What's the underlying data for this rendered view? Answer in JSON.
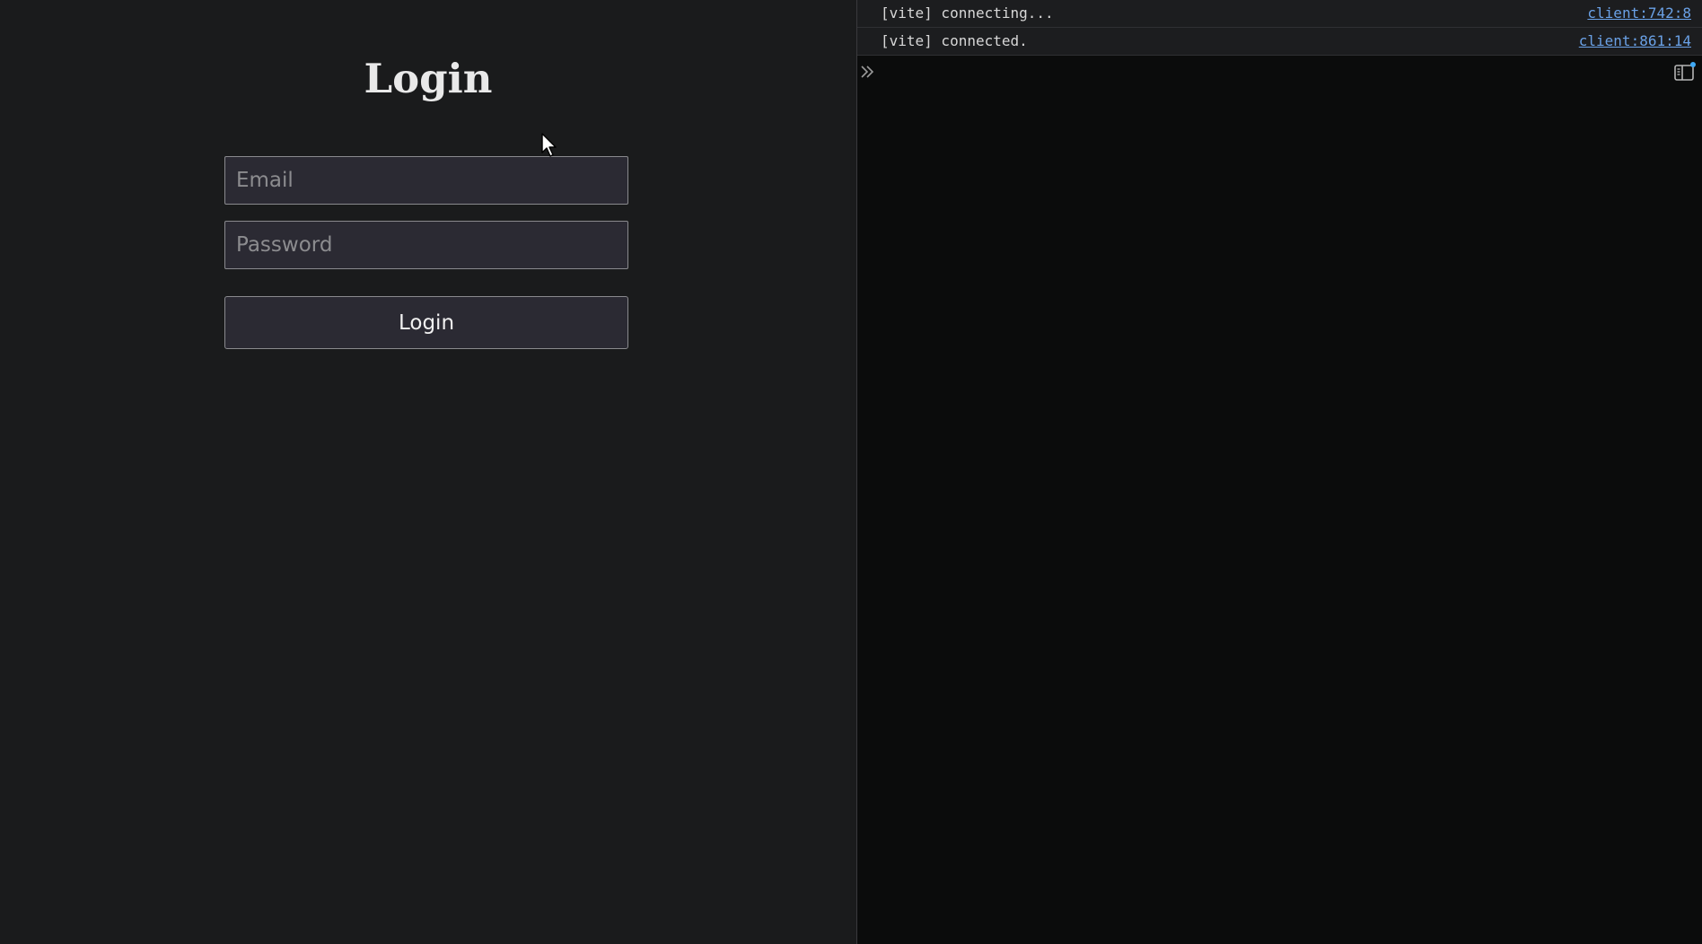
{
  "login": {
    "title": "Login",
    "email_placeholder": "Email",
    "password_placeholder": "Password",
    "button_label": "Login"
  },
  "console": {
    "logs": [
      {
        "message": "[vite] connecting...",
        "source": "client:742:8"
      },
      {
        "message": "[vite] connected.",
        "source": "client:861:14"
      }
    ],
    "prompt_icon": "double-chevron-right-icon",
    "sidebar_icon": "console-sidebar-icon"
  },
  "colors": {
    "page_background": "#1a1b1c",
    "console_background": "#0b0c0c",
    "link": "#6aa1e6",
    "indicator": "#3fa9f5"
  }
}
